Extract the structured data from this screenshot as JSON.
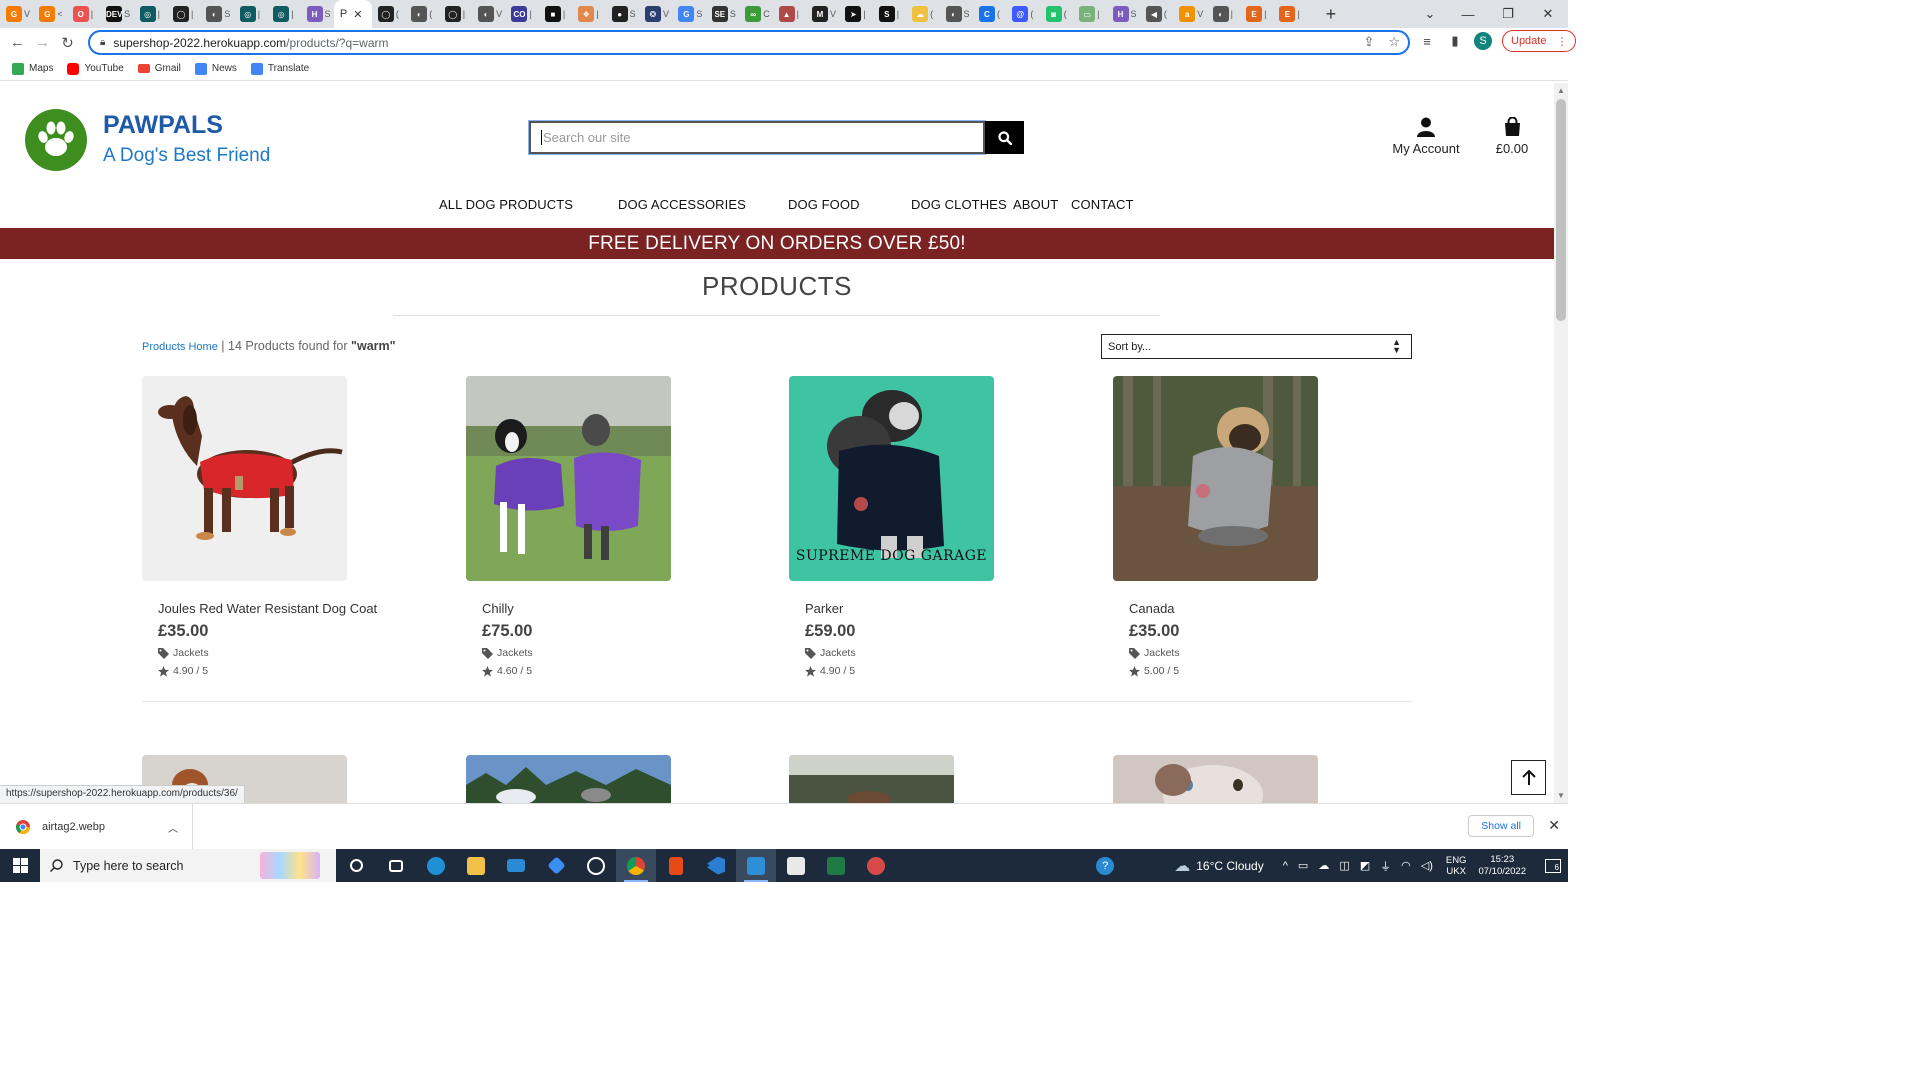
{
  "browser": {
    "tabs": [
      {
        "icon": "G",
        "label": "V",
        "color": "#f57c00"
      },
      {
        "icon": "G",
        "label": "<",
        "color": "#f57c00"
      },
      {
        "icon": "O",
        "label": "|",
        "color": "#ef5350"
      },
      {
        "icon": "DEV",
        "label": "S",
        "color": "#111111"
      },
      {
        "icon": "◎",
        "label": "|",
        "color": "#0f5b63"
      },
      {
        "icon": "◯",
        "label": "|",
        "color": "#222222"
      },
      {
        "icon": "◐",
        "label": "S",
        "color": "#555555"
      },
      {
        "icon": "◎",
        "label": "|",
        "color": "#0f5b63"
      },
      {
        "icon": "◎",
        "label": "|",
        "color": "#0f5b63"
      },
      {
        "icon": "H",
        "label": "S",
        "color": "#7c5cbf"
      },
      {
        "icon": "◯",
        "label": "(",
        "color": "#222222"
      },
      {
        "icon": "◐",
        "label": "(",
        "color": "#555555"
      },
      {
        "icon": "◯",
        "label": "|",
        "color": "#222222"
      },
      {
        "icon": "◐",
        "label": "V",
        "color": "#555555"
      },
      {
        "icon": "CO",
        "label": "|",
        "color": "#3b3b9b"
      },
      {
        "icon": "■",
        "label": "|",
        "color": "#111111"
      },
      {
        "icon": "❖",
        "label": "|",
        "color": "#e0894b"
      },
      {
        "icon": "●",
        "label": "S",
        "color": "#222222"
      },
      {
        "icon": "❂",
        "label": "V",
        "color": "#2c3e70"
      },
      {
        "icon": "G",
        "label": "S",
        "color": "#4285f4"
      },
      {
        "icon": "SE",
        "label": "S",
        "color": "#333333"
      },
      {
        "icon": "∞",
        "label": "C",
        "color": "#3a9b3a"
      },
      {
        "icon": "▲",
        "label": "|",
        "color": "#b04a4a"
      },
      {
        "icon": "M",
        "label": "V",
        "color": "#222222"
      },
      {
        "icon": "➤",
        "label": "|",
        "color": "#111111"
      },
      {
        "icon": "S",
        "label": "|",
        "color": "#111111"
      },
      {
        "icon": "☁",
        "label": "(",
        "color": "#f0c040"
      },
      {
        "icon": "◐",
        "label": "S",
        "color": "#555555"
      },
      {
        "icon": "C",
        "label": "(",
        "color": "#1a73e8"
      },
      {
        "icon": "@",
        "label": "(",
        "color": "#3d5afe"
      },
      {
        "icon": "◙",
        "label": "(",
        "color": "#25c26e"
      },
      {
        "icon": "▭",
        "label": "|",
        "color": "#7ab37a"
      },
      {
        "icon": "H",
        "label": "S",
        "color": "#7c5cbf"
      },
      {
        "icon": "◀",
        "label": "(",
        "color": "#555555"
      },
      {
        "icon": "a",
        "label": "V",
        "color": "#f29200"
      },
      {
        "icon": "◐",
        "label": "|",
        "color": "#555555"
      },
      {
        "icon": "E",
        "label": "|",
        "color": "#e2661b"
      },
      {
        "icon": "E",
        "label": "|",
        "color": "#e2661b"
      }
    ],
    "active_tab_label": "P",
    "url_host": "supershop-2022.herokuapp.com",
    "url_path": "/products/?q=warm",
    "profile_initial": "S",
    "update_label": "Update",
    "bookmarks": [
      {
        "label": "Maps",
        "color": "#34a853"
      },
      {
        "label": "YouTube",
        "color": "#ff0000"
      },
      {
        "label": "Gmail",
        "color": "#ea4335"
      },
      {
        "label": "News",
        "color": "#4285f4"
      },
      {
        "label": "Translate",
        "color": "#4285f4"
      }
    ],
    "status_url": "https://supershop-2022.herokuapp.com/products/36/"
  },
  "site": {
    "brand_name": "PAWPALS",
    "brand_tagline": "A Dog's Best Friend",
    "search_placeholder": "Search our site",
    "account_label": "My Account",
    "bag_total": "£0.00",
    "nav": [
      "ALL DOG PRODUCTS",
      "DOG ACCESSORIES",
      "DOG FOOD",
      "DOG CLOTHES",
      "ABOUT",
      "CONTACT"
    ],
    "banner": "FREE DELIVERY ON ORDERS OVER £50!",
    "page_title": "PRODUCTS",
    "breadcrumb_link": "Products Home",
    "results_prefix": "14 Products found for",
    "results_query": "\"warm\"",
    "sort_label": "Sort by...",
    "products": [
      {
        "name": "Joules Red Water Resistant Dog Coat",
        "price": "£35.00",
        "category": "Jackets",
        "rating": "4.90 / 5"
      },
      {
        "name": "Chilly",
        "price": "£75.00",
        "category": "Jackets",
        "rating": "4.60 / 5"
      },
      {
        "name": "Parker",
        "price": "£59.00",
        "category": "Jackets",
        "rating": "4.90 / 5"
      },
      {
        "name": "Canada",
        "price": "£35.00",
        "category": "Jackets",
        "rating": "5.00 / 5"
      }
    ],
    "parker_image_text": "SUPREME DOG GARAGE"
  },
  "downloads": {
    "file": "airtag2.webp",
    "show_all": "Show all"
  },
  "taskbar": {
    "search_placeholder": "Type here to search",
    "weather": "16°C  Cloudy",
    "lang_top": "ENG",
    "lang_bottom": "UKX",
    "time": "15:23",
    "date": "07/10/2022",
    "notif_count": "6"
  }
}
